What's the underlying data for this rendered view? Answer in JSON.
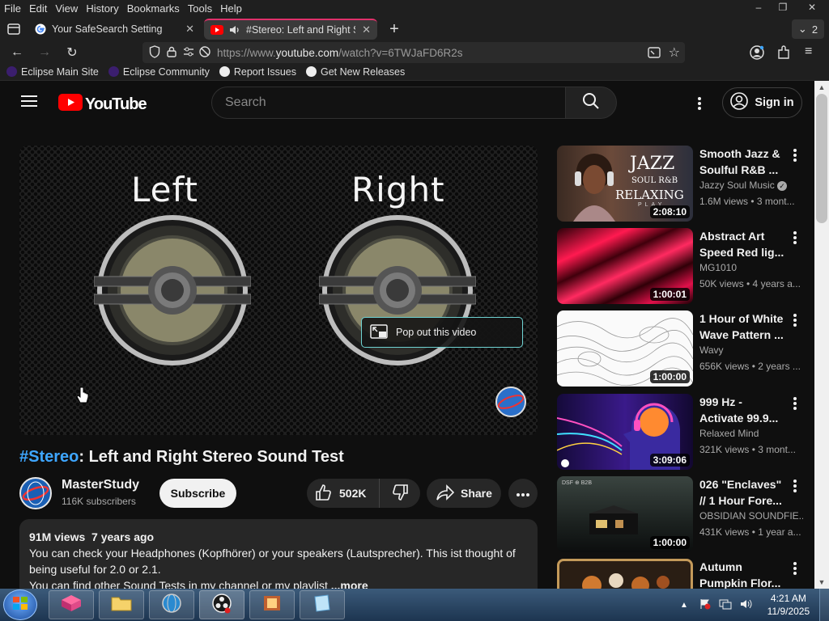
{
  "menubar": {
    "items": [
      "File",
      "Edit",
      "View",
      "History",
      "Bookmarks",
      "Tools",
      "Help"
    ],
    "window_controls": {
      "minimize": "–",
      "restore": "❐",
      "close": "✕"
    }
  },
  "tabs": [
    {
      "title": "Your SafeSearch Setting",
      "icon": "google-icon",
      "close": "✕",
      "active": false
    },
    {
      "title": "#Stereo: Left and Right Stere",
      "icon": "youtube-icon",
      "close": "✕",
      "active": true
    }
  ],
  "tab_new": "+",
  "tab_count": "2",
  "nav": {
    "url_prefix": "https://www.",
    "url_host": "youtube.com",
    "url_path": "/watch?v=6TWJaFD6R2s"
  },
  "bookmarks": [
    {
      "label": "Eclipse Main Site",
      "icon": "eclipse-icon"
    },
    {
      "label": "Eclipse Community",
      "icon": "eclipse-icon"
    },
    {
      "label": "Report Issues",
      "icon": "github-icon"
    },
    {
      "label": "Get New Releases",
      "icon": "github-icon"
    }
  ],
  "youtube": {
    "logo_text": "YouTube",
    "search_placeholder": "Search",
    "signin_label": "Sign in"
  },
  "player": {
    "left_label": "Left",
    "right_label": "Right",
    "popout_label": "Pop out this video"
  },
  "video": {
    "title_tag": "#Stereo",
    "title_rest": ": Left and Right Stereo Sound Test",
    "channel": "MasterStudy",
    "subscribers": "116K subscribers",
    "subscribe_label": "Subscribe",
    "likes": "502K",
    "share_label": "Share",
    "views_date": "91M views  7 years ago",
    "description_1": "You can check your Headphones (Kopfhörer) or your speakers (Lautsprecher). This ist thought of being useful for 2.0 or 2.1.",
    "description_2": "You can find other Sound Tests in my channel or my playlist",
    "more_label": "...more"
  },
  "sidebar": [
    {
      "title": "Smooth Jazz & Soulful R&B ...",
      "channel": "Jazzy Soul Music",
      "verified": true,
      "meta": "1.6M views • 3 mont...",
      "duration": "2:08:10",
      "thumb_text": [
        "JAZZ",
        "SOUL R&B",
        "RELAXING",
        "PLAY"
      ]
    },
    {
      "title": "Abstract Art Speed Red lig...",
      "channel": "MG1010",
      "verified": false,
      "meta": "50K views • 4 years a...",
      "duration": "1:00:01"
    },
    {
      "title": "1 Hour of White Wave Pattern ...",
      "channel": "Wavy",
      "verified": false,
      "meta": "656K views • 2 years ...",
      "duration": "1:00:00"
    },
    {
      "title": "999 Hz - Activate 99.9...",
      "channel": "Relaxed Mind",
      "verified": false,
      "meta": "321K views • 3 mont...",
      "duration": "3:09:06"
    },
    {
      "title": "026 \"Enclaves\" // 1 Hour Fore...",
      "channel": "OBSIDIAN SOUNDFIE...",
      "verified": false,
      "meta": "431K views • 1 year a...",
      "duration": "1:00:00",
      "thumb_text": [
        "DSF ⊕ B2B"
      ]
    },
    {
      "title": "Autumn Pumpkin Flor...",
      "channel": "",
      "verified": false,
      "meta": "",
      "duration": ""
    }
  ],
  "taskbar": {
    "time": "4:21 AM",
    "date": "11/9/2025"
  },
  "colors": {
    "accent_link": "#3ea6ff",
    "youtube_red": "#ff0000",
    "tab_accent": "#e0306b"
  }
}
